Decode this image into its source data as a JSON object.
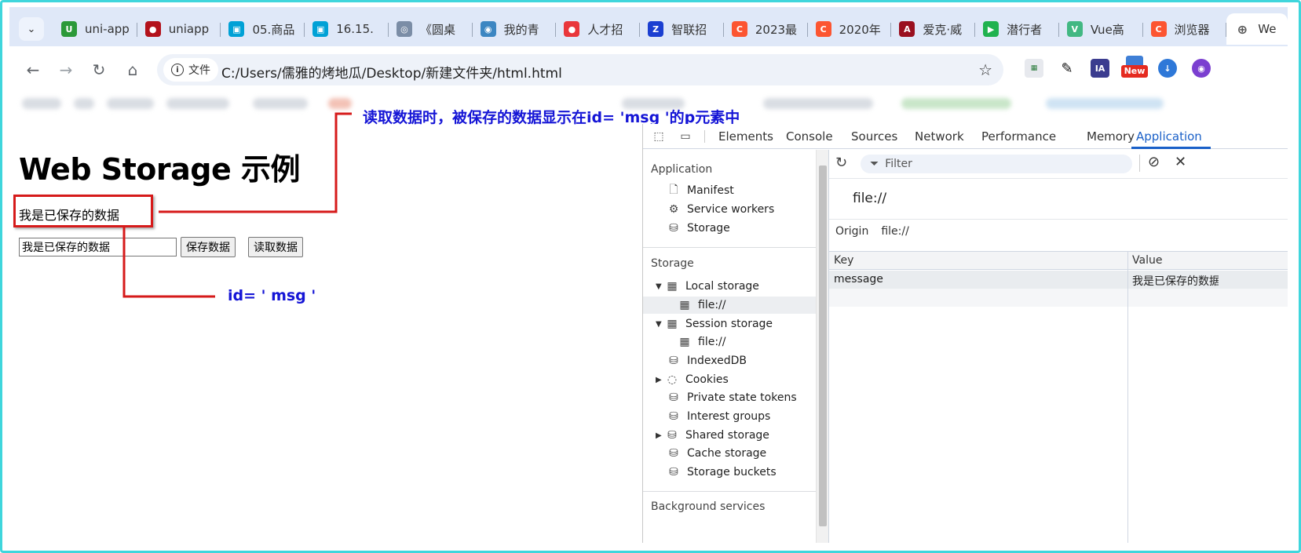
{
  "browser": {
    "tabs": [
      {
        "label": "uni-app",
        "icon": "uniapp-icon",
        "color": "#2b9939",
        "glyph": "U"
      },
      {
        "label": "uniapp",
        "icon": "uniapp-red-icon",
        "color": "#b3121c",
        "glyph": "●"
      },
      {
        "label": "05.商品",
        "icon": "bilibili-icon",
        "color": "#00a1d6",
        "glyph": "▣"
      },
      {
        "label": "16.15.",
        "icon": "bilibili-icon",
        "color": "#00a1d6",
        "glyph": "▣"
      },
      {
        "label": "《圆桌",
        "icon": "robot-icon",
        "color": "#7b8da6",
        "glyph": "◎"
      },
      {
        "label": "我的青",
        "icon": "eye-icon",
        "color": "#3c86c2",
        "glyph": "◉"
      },
      {
        "label": "人才招",
        "icon": "job-icon",
        "color": "#e9363b",
        "glyph": "●"
      },
      {
        "label": "智联招",
        "icon": "zhaopin-icon",
        "color": "#1b3fd1",
        "glyph": "Z"
      },
      {
        "label": "2023最",
        "icon": "csdn-icon",
        "color": "#fc5531",
        "glyph": "C"
      },
      {
        "label": "2020年",
        "icon": "csdn-icon",
        "color": "#fc5531",
        "glyph": "C"
      },
      {
        "label": "爱克·威",
        "icon": "aida-icon",
        "color": "#9a1020",
        "glyph": "A"
      },
      {
        "label": "潜行者",
        "icon": "play-icon",
        "color": "#20b24f",
        "glyph": "▶"
      },
      {
        "label": "Vue高",
        "icon": "vue-icon",
        "color": "#42b883",
        "glyph": "V"
      },
      {
        "label": "浏览器",
        "icon": "csdn-icon",
        "color": "#fc5531",
        "glyph": "C"
      }
    ],
    "active_tab": {
      "label": "We",
      "icon": "globe-icon"
    },
    "address_chip": "文件",
    "url": "C:/Users/儒雅的烤地瓜/Desktop/新建文件夹/html.html",
    "ext_new_badge": "New"
  },
  "page": {
    "title": "Web Storage 示例",
    "message": "我是已保存的数据",
    "input_value": "我是已保存的数据",
    "save_button": "保存数据",
    "read_button": "读取数据"
  },
  "annotations": {
    "top": "读取数据时，被保存的数据显示在id= 'msg '的p元素中",
    "bottom": "id= ' msg '"
  },
  "devtools": {
    "tabs": [
      "Elements",
      "Console",
      "Sources",
      "Network",
      "Performance",
      "Memory",
      "Application"
    ],
    "active_tab": "Application",
    "sidebar": {
      "section_application": "Application",
      "app_items": [
        "Manifest",
        "Service workers",
        "Storage"
      ],
      "section_storage": "Storage",
      "local_storage": "Local storage",
      "local_storage_child": "file://",
      "session_storage": "Session storage",
      "session_storage_child": "file://",
      "indexeddb": "IndexedDB",
      "cookies": "Cookies",
      "private_state_tokens": "Private state tokens",
      "interest_groups": "Interest groups",
      "shared_storage": "Shared storage",
      "cache_storage": "Cache storage",
      "storage_buckets": "Storage buckets",
      "section_background": "Background services"
    },
    "filter_placeholder": "Filter",
    "origin_title": "file://",
    "origin_label": "Origin",
    "origin_value": "file://",
    "table": {
      "headers": [
        "Key",
        "Value"
      ],
      "rows": [
        {
          "key": "message",
          "value": "我是已保存的数据"
        }
      ]
    }
  },
  "colors": {
    "annotation_text": "#1515d6",
    "annotation_line": "#d61a1a",
    "frame": "#3fd6dc",
    "devtools_accent": "#1a60c8"
  }
}
